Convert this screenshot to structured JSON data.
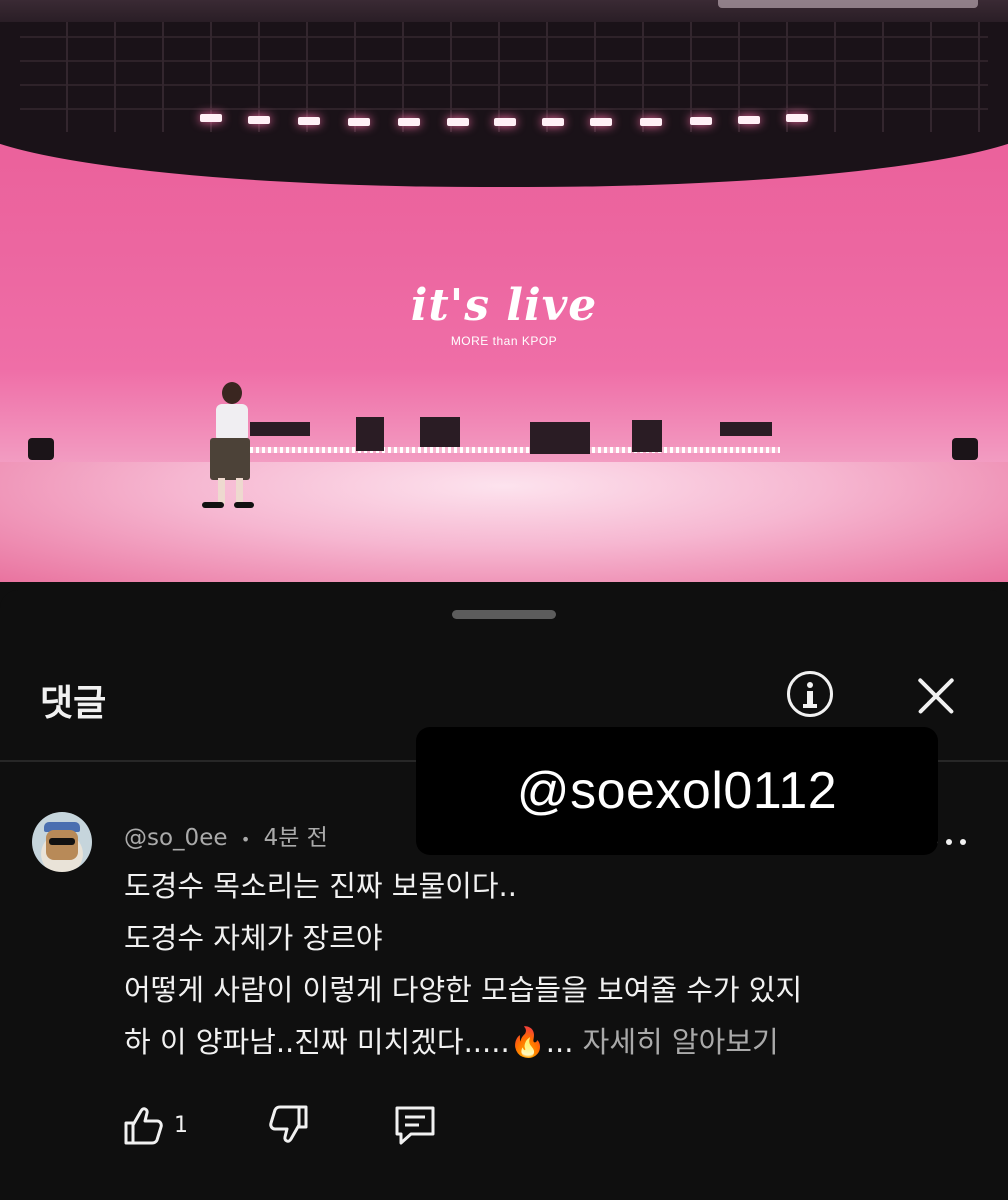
{
  "video": {
    "logo_title": "it's live",
    "logo_subtitle": "MORE than KPOP"
  },
  "comments_panel": {
    "title": "댓글",
    "info_icon": "info-circle-icon",
    "close_icon": "close-icon"
  },
  "comment": {
    "author": "@so_0ee",
    "separator": "•",
    "time": "4분 전",
    "lines": [
      "도경수 목소리는 진짜 보물이다..",
      "도경수 자체가 장르야",
      "어떻게 사람이 이렇게 다양한 모습들을 보여줄 수가 있지",
      "하 이 양파남..진짜 미치겠다.....🔥..."
    ],
    "more_label": "자세히 알아보기",
    "like_count": "1"
  },
  "watermark": {
    "text": "@soexol0112"
  },
  "colors": {
    "background": "#0f0f0f",
    "secondary_text": "#aaaaaa",
    "stage_pink": "#ec66a0"
  }
}
